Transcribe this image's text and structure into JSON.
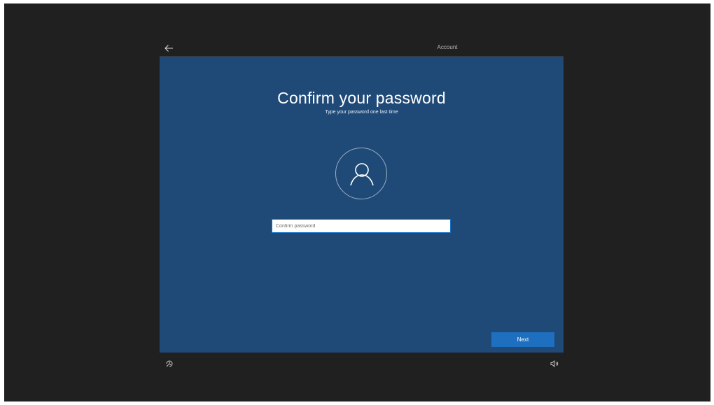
{
  "header": {
    "back_icon": "back-arrow-icon",
    "active_tab": "Account"
  },
  "main": {
    "title": "Confirm your password",
    "subtitle": "Type your password one last time",
    "avatar_icon": "user-icon",
    "password": {
      "placeholder": "Confirm password",
      "value": ""
    },
    "next_label": "Next"
  },
  "footer": {
    "left_icon": "ease-of-access-icon",
    "right_icon": "volume-icon"
  },
  "colors": {
    "screen_bg": "#202020",
    "panel_bg": "#1f4a78",
    "accent": "#1e6fc0",
    "text": "#ffffff"
  }
}
